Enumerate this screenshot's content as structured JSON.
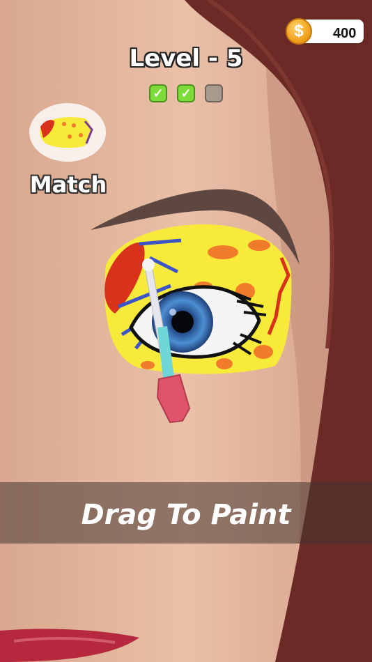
{
  "hud": {
    "coins": "400",
    "coin_symbol": "$",
    "level_title": "Level - 5",
    "progress": [
      {
        "state": "done",
        "mark": "✓"
      },
      {
        "state": "done",
        "mark": "✓"
      },
      {
        "state": "todo",
        "mark": ""
      }
    ]
  },
  "match": {
    "label": "Match"
  },
  "hint": {
    "text": "Drag To Paint"
  },
  "colors": {
    "skin": "#e4b79e",
    "hair": "#6b2a25",
    "paint_yellow": "#f7ea3a",
    "paint_red": "#d8311c",
    "paint_blue": "#3b55c9",
    "iris": "#3a7fc7",
    "brush_handle": "#e0546a",
    "brush_ferrule": "#6fd6d6"
  }
}
